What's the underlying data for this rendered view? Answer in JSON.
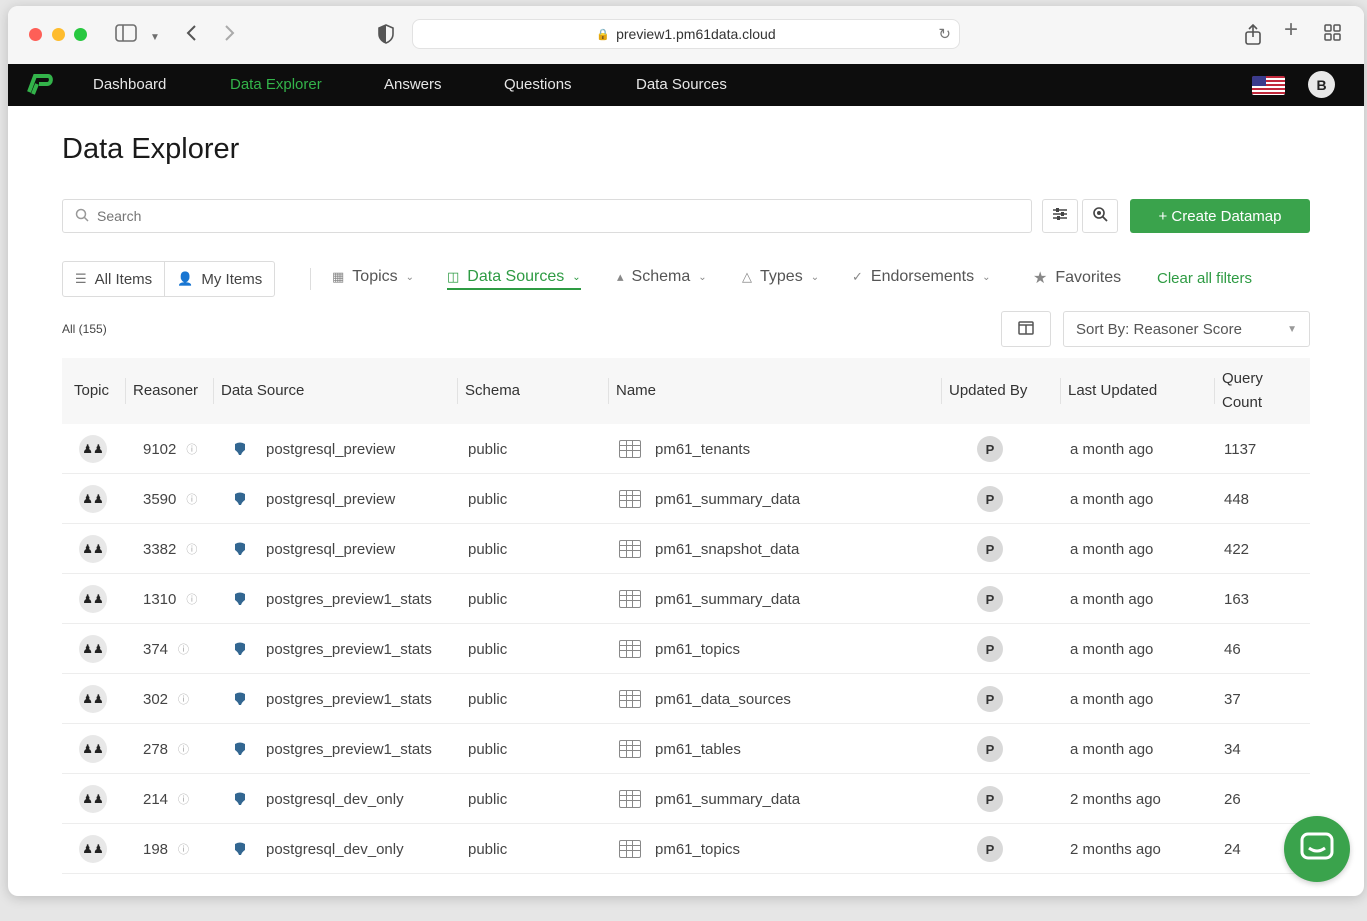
{
  "browser": {
    "url": "preview1.pm61data.cloud"
  },
  "nav": {
    "items": [
      {
        "label": "Dashboard"
      },
      {
        "label": "Data Explorer"
      },
      {
        "label": "Answers"
      },
      {
        "label": "Questions"
      },
      {
        "label": "Data Sources"
      }
    ],
    "active": "Data Explorer",
    "user_initial": "B"
  },
  "page": {
    "title": "Data Explorer",
    "search_placeholder": "Search",
    "create_button": "+ Create Datamap"
  },
  "filters": {
    "segments": [
      "All Items",
      "My Items"
    ],
    "items": [
      {
        "label": "Topics",
        "icon": "topics-icon"
      },
      {
        "label": "Data Sources",
        "icon": "database-icon",
        "active": true
      },
      {
        "label": "Schema",
        "icon": "schema-icon"
      },
      {
        "label": "Types",
        "icon": "types-icon"
      },
      {
        "label": "Endorsements",
        "icon": "endorsement-icon"
      },
      {
        "label": "Favorites",
        "icon": "star-icon"
      }
    ],
    "clear_label": "Clear all filters"
  },
  "results": {
    "count_label": "All (155)",
    "sort_label": "Sort By: Reasoner Score"
  },
  "table": {
    "headers": {
      "topic": "Topic",
      "reasoner": "Reasoner",
      "data_source": "Data Source",
      "schema": "Schema",
      "name": "Name",
      "updated_by": "Updated By",
      "last_updated": "Last Updated",
      "query_count": "Query Count"
    },
    "rows": [
      {
        "reasoner": "9102",
        "data_source": "postgresql_preview",
        "schema": "public",
        "name": "pm61_tenants",
        "updated_by": "P",
        "last_updated": "a month ago",
        "query_count": "1137"
      },
      {
        "reasoner": "3590",
        "data_source": "postgresql_preview",
        "schema": "public",
        "name": "pm61_summary_data",
        "updated_by": "P",
        "last_updated": "a month ago",
        "query_count": "448"
      },
      {
        "reasoner": "3382",
        "data_source": "postgresql_preview",
        "schema": "public",
        "name": "pm61_snapshot_data",
        "updated_by": "P",
        "last_updated": "a month ago",
        "query_count": "422"
      },
      {
        "reasoner": "1310",
        "data_source": "postgres_preview1_stats",
        "schema": "public",
        "name": "pm61_summary_data",
        "updated_by": "P",
        "last_updated": "a month ago",
        "query_count": "163"
      },
      {
        "reasoner": "374",
        "data_source": "postgres_preview1_stats",
        "schema": "public",
        "name": "pm61_topics",
        "updated_by": "P",
        "last_updated": "a month ago",
        "query_count": "46"
      },
      {
        "reasoner": "302",
        "data_source": "postgres_preview1_stats",
        "schema": "public",
        "name": "pm61_data_sources",
        "updated_by": "P",
        "last_updated": "a month ago",
        "query_count": "37"
      },
      {
        "reasoner": "278",
        "data_source": "postgres_preview1_stats",
        "schema": "public",
        "name": "pm61_tables",
        "updated_by": "P",
        "last_updated": "a month ago",
        "query_count": "34"
      },
      {
        "reasoner": "214",
        "data_source": "postgresql_dev_only",
        "schema": "public",
        "name": "pm61_summary_data",
        "updated_by": "P",
        "last_updated": "2 months ago",
        "query_count": "26"
      },
      {
        "reasoner": "198",
        "data_source": "postgresql_dev_only",
        "schema": "public",
        "name": "pm61_topics",
        "updated_by": "P",
        "last_updated": "2 months ago",
        "query_count": "24"
      }
    ]
  },
  "colors": {
    "accent": "#3aa34c",
    "nav_bg": "#0d0d0d"
  }
}
